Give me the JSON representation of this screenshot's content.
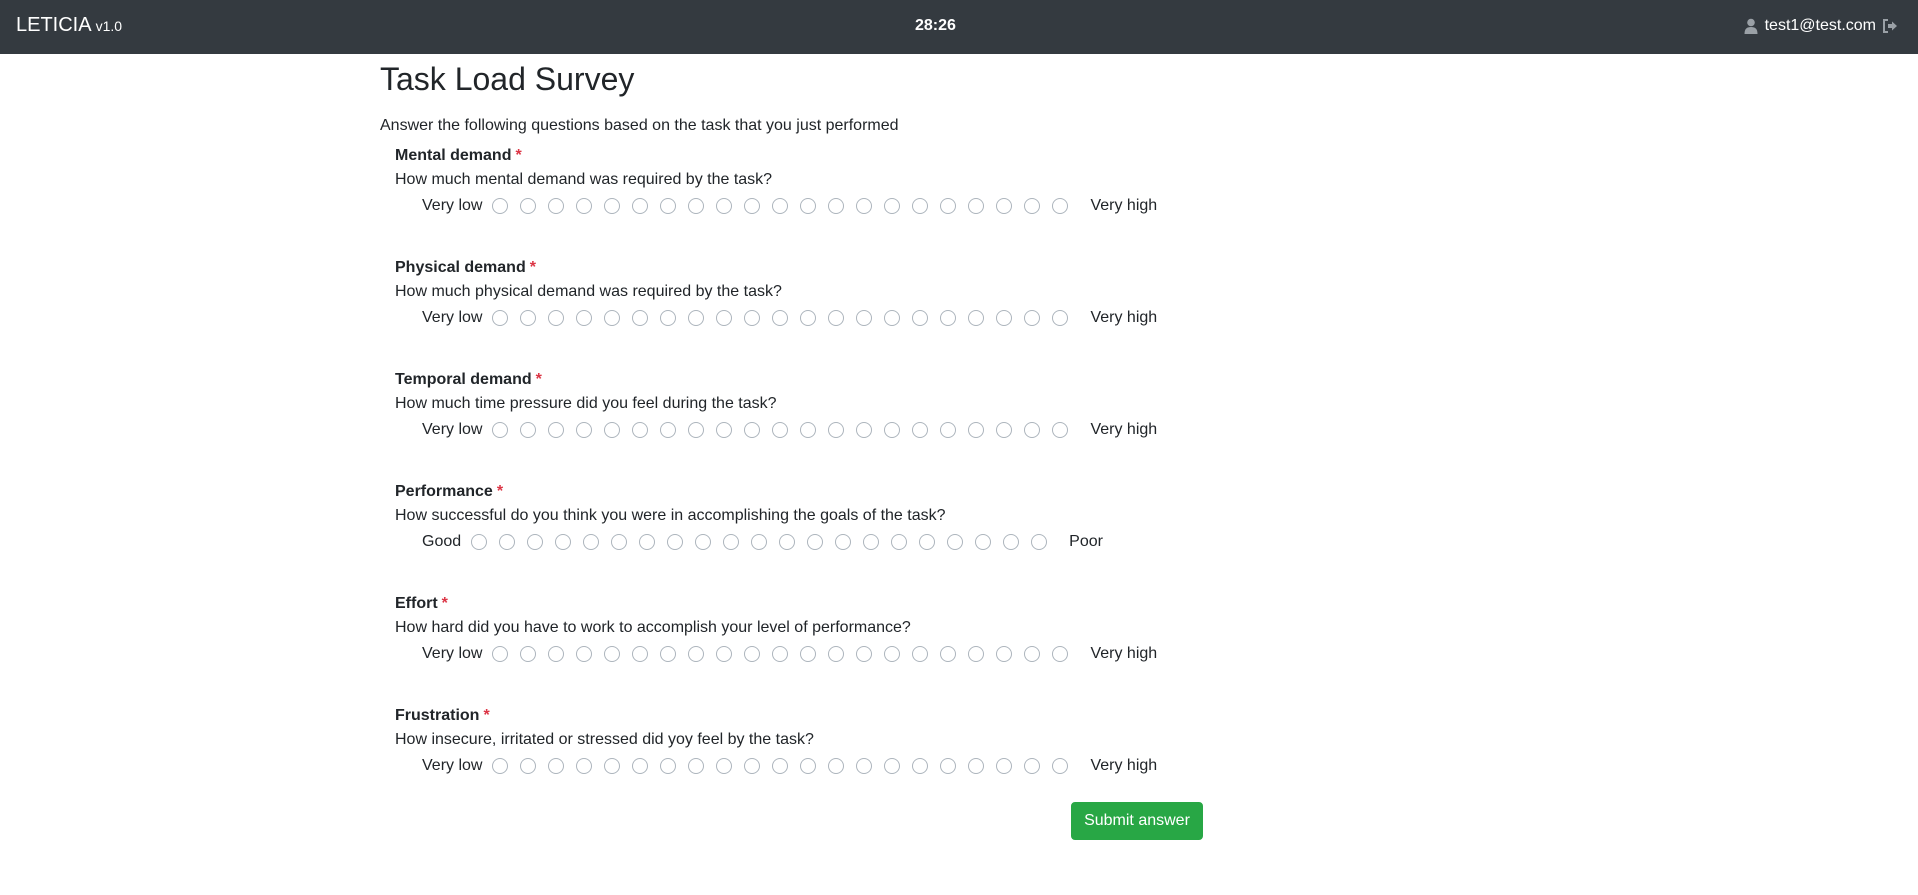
{
  "navbar": {
    "brand": "LETICIA",
    "version": "v1.0",
    "timer": "28:26",
    "user_email": "test1@test.com",
    "user_icon": "user-icon",
    "logout_icon": "sign-out-icon"
  },
  "page": {
    "title": "Task Load Survey",
    "intro": "Answer the following questions based on the task that you just performed"
  },
  "questions": [
    {
      "title": "Mental demand",
      "required": "*",
      "text": "How much mental demand was required by the task?",
      "low": "Very low",
      "high": "Very high"
    },
    {
      "title": "Physical demand",
      "required": "*",
      "text": "How much physical demand was required by the task?",
      "low": "Very low",
      "high": "Very high"
    },
    {
      "title": "Temporal demand",
      "required": "*",
      "text": "How much time pressure did you feel during the task?",
      "low": "Very low",
      "high": "Very high"
    },
    {
      "title": "Performance",
      "required": "*",
      "text": "How successful do you think you were in accomplishing the goals of the task?",
      "low": "Good",
      "high": "Poor"
    },
    {
      "title": "Effort",
      "required": "*",
      "text": "How hard did you have to work to accomplish your level of performance?",
      "low": "Very low",
      "high": "Very high"
    },
    {
      "title": "Frustration",
      "required": "*",
      "text": "How insecure, irritated or stressed did yoy feel by the task?",
      "low": "Very low",
      "high": "Very high"
    }
  ],
  "scale_points": 21,
  "submit_label": "Submit answer",
  "colors": {
    "navbar": "#343a40",
    "required": "#dc3545",
    "submit": "#28a745"
  }
}
